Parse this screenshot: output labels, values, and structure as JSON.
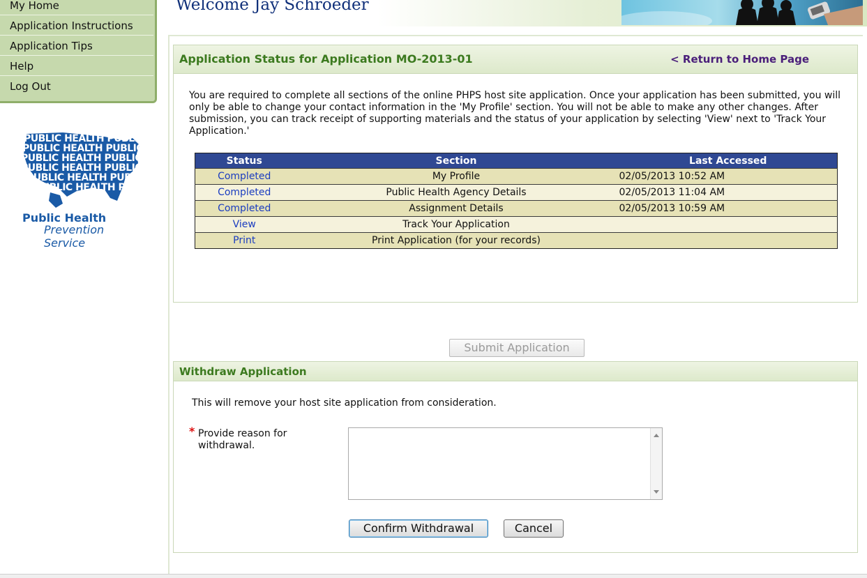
{
  "nav": {
    "items": [
      {
        "label": "My Home"
      },
      {
        "label": "Application Instructions"
      },
      {
        "label": "Application Tips"
      },
      {
        "label": "Help"
      },
      {
        "label": "Log Out"
      }
    ]
  },
  "logo": {
    "map_text": "PUBLIC HEALTH PUBLIC",
    "name_line1": "Public Health",
    "name_line2": "Prevention Service"
  },
  "header": {
    "welcome": "Welcome Jay Schroeder"
  },
  "status_panel": {
    "title": "Application Status for Application MO-2013-01",
    "return_link": "< Return to Home Page",
    "intro": "You are required to complete all sections of the online PHPS host site application. Once your application has been submitted, you will only be able to change your contact information in the 'My Profile' section. You will not be able to make any other changes. After submission, you can track receipt of supporting materials and the status of your application by selecting 'View' next to 'Track Your Application.'",
    "table": {
      "headers": {
        "status": "Status",
        "section": "Section",
        "last_accessed": "Last Accessed"
      },
      "rows": [
        {
          "status": "Completed",
          "section": "My Profile",
          "last_accessed": "02/05/2013 10:52 AM"
        },
        {
          "status": "Completed",
          "section": "Public Health Agency Details",
          "last_accessed": "02/05/2013 11:04 AM"
        },
        {
          "status": "Completed",
          "section": "Assignment Details",
          "last_accessed": "02/05/2013 10:59 AM"
        },
        {
          "status": "View",
          "section": "Track Your Application",
          "last_accessed": ""
        },
        {
          "status": "Print",
          "section": "Print Application (for your records)",
          "last_accessed": ""
        }
      ]
    }
  },
  "submit_button": "Submit Application",
  "withdraw_panel": {
    "title": "Withdraw Application",
    "note": "This will remove your host site application from consideration.",
    "required_mark": "*",
    "reason_label": "Provide reason for withdrawal.",
    "reason_value": "",
    "confirm_label": "Confirm Withdrawal",
    "cancel_label": "Cancel"
  },
  "colors": {
    "nav_bg": "#c6d9ad",
    "panel_title": "#3c7a1f",
    "table_header": "#2f4893",
    "link": "#1a3cc0",
    "return_link": "#4a1f7a",
    "welcome": "#10307a",
    "logo_blue": "#1a5aa6"
  }
}
